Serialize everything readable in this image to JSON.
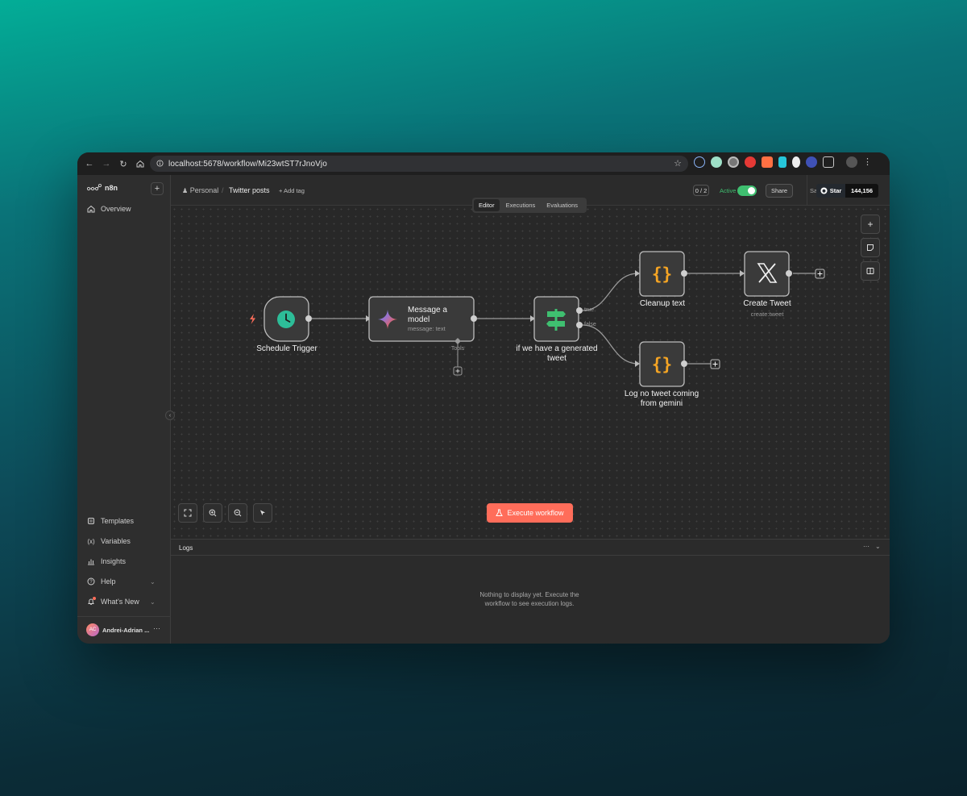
{
  "browser": {
    "url": "localhost:5678/workflow/Mi23wtST7rJnoVjo"
  },
  "sidebar": {
    "brand": "n8n",
    "overview_label": "Overview",
    "bottom_items": [
      {
        "label": "Templates"
      },
      {
        "label": "Variables"
      },
      {
        "label": "Insights"
      },
      {
        "label": "Help"
      },
      {
        "label": "What's New"
      }
    ],
    "user": {
      "initials": "AC",
      "name": "Andrei-Adrian ..."
    }
  },
  "header": {
    "project": "Personal",
    "workflow_name": "Twitter posts",
    "add_tag": "+ Add tag",
    "counter": "0 / 2",
    "active_label": "Active",
    "share_label": "Share",
    "saved_label": "Saved",
    "github_star_label": "Star",
    "github_star_count": "144,156"
  },
  "tabs": [
    {
      "label": "Editor",
      "active": true
    },
    {
      "label": "Executions",
      "active": false
    },
    {
      "label": "Evaluations",
      "active": false
    }
  ],
  "nodes": {
    "schedule": {
      "label": "Schedule Trigger",
      "icon": "clock-icon"
    },
    "message": {
      "label_line1": "Message a",
      "label_line2": "model",
      "sub": "message: text",
      "tools_label": "Tools",
      "icon": "gemini-icon"
    },
    "if": {
      "label_line1": "if we have a generated",
      "label_line2": "tweet",
      "true_label": "true",
      "false_label": "false",
      "icon": "signpost-icon"
    },
    "cleanup": {
      "label": "Cleanup text",
      "icon": "code-braces-icon"
    },
    "create_tweet": {
      "label": "Create Tweet",
      "sub": "create:tweet",
      "icon": "x-logo-icon"
    },
    "log": {
      "label_line1": "Log no tweet coming",
      "label_line2": "from gemini",
      "icon": "code-braces-icon"
    }
  },
  "canvas_controls": {
    "execute_label": "Execute workflow"
  },
  "logs": {
    "title": "Logs",
    "empty_line1": "Nothing to display yet. Execute the",
    "empty_line2": "workflow to see execution logs."
  },
  "colors": {
    "accent": "#ff6d5a",
    "active_toggle": "#3fbf70",
    "trigger_icon": "#2dbd98",
    "code_braces": "#f5a524",
    "if_icon": "#3fbf70"
  }
}
